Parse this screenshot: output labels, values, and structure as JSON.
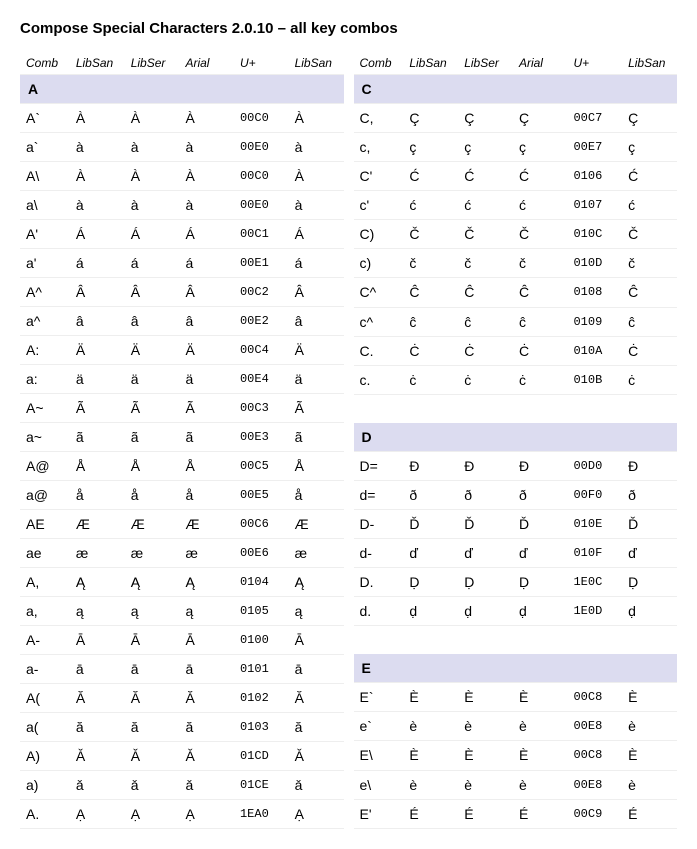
{
  "title": "Compose Special Characters 2.0.10 – all key combos",
  "headers": [
    "Comb",
    "LibSan",
    "LibSer",
    "Arial",
    "U+",
    "LibSan"
  ],
  "left": [
    {
      "section": "A"
    },
    {
      "row": [
        "A`",
        "À",
        "À",
        "À",
        "00C0",
        "À"
      ]
    },
    {
      "row": [
        "a`",
        "à",
        "à",
        "à",
        "00E0",
        "à"
      ]
    },
    {
      "row": [
        "A\\",
        "À",
        "À",
        "À",
        "00C0",
        "À"
      ]
    },
    {
      "row": [
        "a\\",
        "à",
        "à",
        "à",
        "00E0",
        "à"
      ]
    },
    {
      "row": [
        "A'",
        "Á",
        "Á",
        "Á",
        "00C1",
        "Á"
      ]
    },
    {
      "row": [
        "a'",
        "á",
        "á",
        "á",
        "00E1",
        "á"
      ]
    },
    {
      "row": [
        "A^",
        "Â",
        "Â",
        "Â",
        "00C2",
        "Â"
      ]
    },
    {
      "row": [
        "a^",
        "â",
        "â",
        "â",
        "00E2",
        "â"
      ]
    },
    {
      "row": [
        "A:",
        "Ä",
        "Ä",
        "Ä",
        "00C4",
        "Ä"
      ]
    },
    {
      "row": [
        "a:",
        "ä",
        "ä",
        "ä",
        "00E4",
        "ä"
      ]
    },
    {
      "row": [
        "A~",
        "Ã",
        "Ã",
        "Ã",
        "00C3",
        "Ã"
      ]
    },
    {
      "row": [
        "a~",
        "ã",
        "ã",
        "ã",
        "00E3",
        "ã"
      ]
    },
    {
      "row": [
        "A@",
        "Å",
        "Å",
        "Å",
        "00C5",
        "Å"
      ]
    },
    {
      "row": [
        "a@",
        "å",
        "å",
        "å",
        "00E5",
        "å"
      ]
    },
    {
      "row": [
        "AE",
        "Æ",
        "Æ",
        "Æ",
        "00C6",
        "Æ"
      ]
    },
    {
      "row": [
        "ae",
        "æ",
        "æ",
        "æ",
        "00E6",
        "æ"
      ]
    },
    {
      "row": [
        "A,",
        "Ą",
        "Ą",
        "Ą",
        "0104",
        "Ą"
      ]
    },
    {
      "row": [
        "a,",
        "ą",
        "ą",
        "ą",
        "0105",
        "ą"
      ]
    },
    {
      "row": [
        "A-",
        "Ā",
        "Ā",
        "Ā",
        "0100",
        "Ā"
      ]
    },
    {
      "row": [
        "a-",
        "ā",
        "ā",
        "ā",
        "0101",
        "ā"
      ]
    },
    {
      "row": [
        "A(",
        "Ă",
        "Ă",
        "Ă",
        "0102",
        "Ă"
      ]
    },
    {
      "row": [
        "a(",
        "ă",
        "ă",
        "ă",
        "0103",
        "ă"
      ]
    },
    {
      "row": [
        "A)",
        "Ǎ",
        "Ǎ",
        "Ǎ",
        "01CD",
        "Ǎ"
      ]
    },
    {
      "row": [
        "a)",
        "ǎ",
        "ǎ",
        "ǎ",
        "01CE",
        "ǎ"
      ]
    },
    {
      "row": [
        "A.",
        "Ạ",
        "Ạ",
        "Ạ",
        "1EA0",
        "Ạ"
      ]
    }
  ],
  "right": [
    {
      "section": "C"
    },
    {
      "row": [
        "C,",
        "Ç",
        "Ç",
        "Ç",
        "00C7",
        "Ç"
      ]
    },
    {
      "row": [
        "c,",
        "ç",
        "ç",
        "ç",
        "00E7",
        "ç"
      ]
    },
    {
      "row": [
        "C'",
        "Ć",
        "Ć",
        "Ć",
        "0106",
        "Ć"
      ]
    },
    {
      "row": [
        "c'",
        "ć",
        "ć",
        "ć",
        "0107",
        "ć"
      ]
    },
    {
      "row": [
        "C)",
        "Č",
        "Č",
        "Č",
        "010C",
        "Č"
      ]
    },
    {
      "row": [
        "c)",
        "č",
        "č",
        "č",
        "010D",
        "č"
      ]
    },
    {
      "row": [
        "C^",
        "Ĉ",
        "Ĉ",
        "Ĉ",
        "0108",
        "Ĉ"
      ]
    },
    {
      "row": [
        "c^",
        "ĉ",
        "ĉ",
        "ĉ",
        "0109",
        "ĉ"
      ]
    },
    {
      "row": [
        "C.",
        "Ċ",
        "Ċ",
        "Ċ",
        "010A",
        "Ċ"
      ]
    },
    {
      "row": [
        "c.",
        "ċ",
        "ċ",
        "ċ",
        "010B",
        "ċ"
      ]
    },
    {
      "spacer": true
    },
    {
      "section": "D"
    },
    {
      "row": [
        "D=",
        "Đ",
        "Đ",
        "Đ",
        "00D0",
        "Đ"
      ]
    },
    {
      "row": [
        "d=",
        "ð",
        "ð",
        "ð",
        "00F0",
        "ð"
      ]
    },
    {
      "row": [
        "D-",
        "Ď",
        "Ď",
        "Ď",
        "010E",
        "Ď"
      ]
    },
    {
      "row": [
        "d-",
        "ď",
        "ď",
        "ď",
        "010F",
        "ď"
      ]
    },
    {
      "row": [
        "D.",
        "Ḍ",
        "Ḍ",
        "Ḍ",
        "1E0C",
        "Ḍ"
      ]
    },
    {
      "row": [
        "d.",
        "ḍ",
        "ḍ",
        "ḍ",
        "1E0D",
        "ḍ"
      ]
    },
    {
      "spacer": true
    },
    {
      "section": "E"
    },
    {
      "row": [
        "E`",
        "È",
        "È",
        "È",
        "00C8",
        "È"
      ]
    },
    {
      "row": [
        "e`",
        "è",
        "è",
        "è",
        "00E8",
        "è"
      ]
    },
    {
      "row": [
        "E\\",
        "È",
        "È",
        "È",
        "00C8",
        "È"
      ]
    },
    {
      "row": [
        "e\\",
        "è",
        "è",
        "è",
        "00E8",
        "è"
      ]
    },
    {
      "row": [
        "E'",
        "É",
        "É",
        "É",
        "00C9",
        "É"
      ]
    }
  ]
}
